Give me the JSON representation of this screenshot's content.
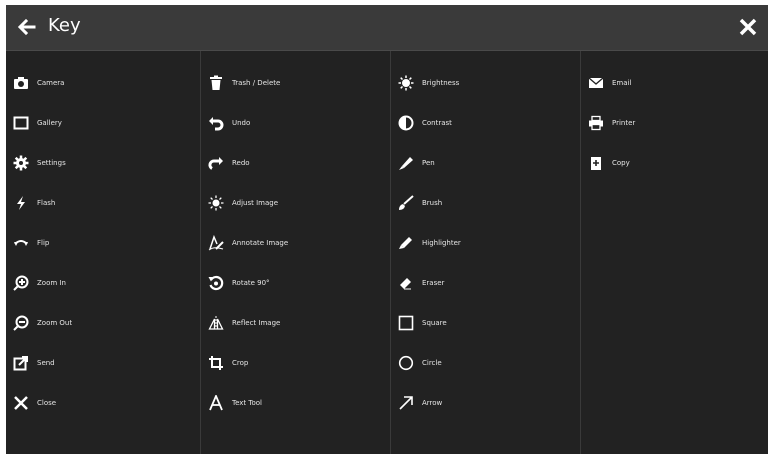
{
  "header": {
    "title": "Key",
    "back_icon": "arrow-left-icon",
    "close_icon": "close-icon"
  },
  "columns": [
    [
      {
        "label": "Camera",
        "icon": "camera-icon"
      },
      {
        "label": "Gallery",
        "icon": "gallery-icon"
      },
      {
        "label": "Settings",
        "icon": "gear-icon"
      },
      {
        "label": "Flash",
        "icon": "flash-icon"
      },
      {
        "label": "Flip",
        "icon": "flip-icon"
      },
      {
        "label": "Zoom In",
        "icon": "zoom-in-icon"
      },
      {
        "label": "Zoom Out",
        "icon": "zoom-out-icon"
      },
      {
        "label": "Send",
        "icon": "send-icon"
      },
      {
        "label": "Close",
        "icon": "close-icon"
      }
    ],
    [
      {
        "label": "Trash / Delete",
        "icon": "trash-icon"
      },
      {
        "label": "Undo",
        "icon": "undo-icon"
      },
      {
        "label": "Redo",
        "icon": "redo-icon"
      },
      {
        "label": "Adjust Image",
        "icon": "adjust-image-icon"
      },
      {
        "label": "Annotate Image",
        "icon": "annotate-icon"
      },
      {
        "label": "Rotate 90°",
        "icon": "rotate-icon"
      },
      {
        "label": "Reflect Image",
        "icon": "reflect-icon"
      },
      {
        "label": "Crop",
        "icon": "crop-icon"
      },
      {
        "label": "Text Tool",
        "icon": "text-tool-icon"
      }
    ],
    [
      {
        "label": "Brightness",
        "icon": "brightness-icon"
      },
      {
        "label": "Contrast",
        "icon": "contrast-icon"
      },
      {
        "label": "Pen",
        "icon": "pen-icon"
      },
      {
        "label": "Brush",
        "icon": "brush-icon"
      },
      {
        "label": "Highlighter",
        "icon": "highlighter-icon"
      },
      {
        "label": "Eraser",
        "icon": "eraser-icon"
      },
      {
        "label": "Square",
        "icon": "square-icon"
      },
      {
        "label": "Circle",
        "icon": "circle-icon"
      },
      {
        "label": "Arrow",
        "icon": "arrow-icon"
      }
    ],
    [
      {
        "label": "Email",
        "icon": "email-icon"
      },
      {
        "label": "Printer",
        "icon": "printer-icon"
      },
      {
        "label": "Copy",
        "icon": "copy-icon"
      }
    ]
  ]
}
